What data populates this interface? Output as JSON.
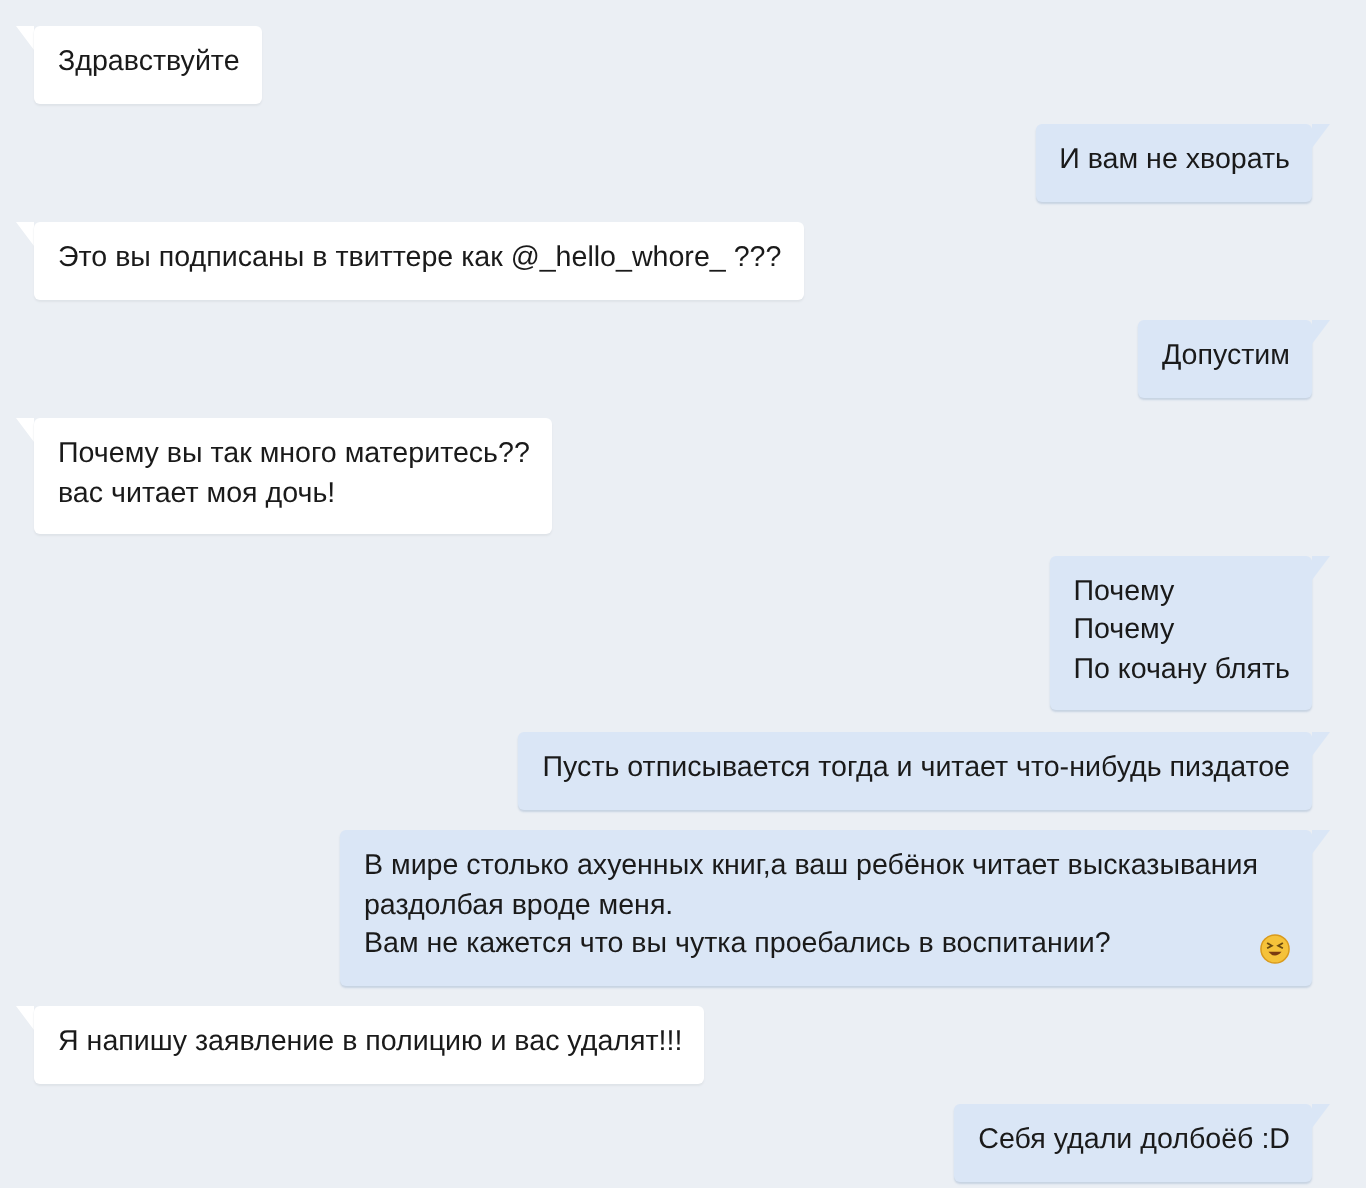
{
  "messages": [
    {
      "kind": "incoming",
      "lines": [
        "Здравствуйте"
      ]
    },
    {
      "kind": "outgoing",
      "lines": [
        "И вам не хворать"
      ]
    },
    {
      "kind": "incoming",
      "lines": [
        "Это вы подписаны в твиттере как @_hello_whore_ ???"
      ]
    },
    {
      "kind": "outgoing",
      "lines": [
        "Допустим"
      ]
    },
    {
      "kind": "incoming",
      "lines": [
        "Почему вы так много материтесь??",
        "вас читает моя дочь!"
      ]
    },
    {
      "kind": "outgoing",
      "lines": [
        "Почему",
        "Почему",
        "По кочану блять"
      ]
    },
    {
      "kind": "outgoing",
      "lines": [
        "Пусть отписывается тогда и читает что-нибудь пиздатое"
      ]
    },
    {
      "kind": "outgoing",
      "lines": [
        "В мире столько ахуенных книг,а ваш ребёнок читает высказывания",
        "раздолбая вроде меня.",
        "Вам не кажется что вы чутка проебались в воспитании?"
      ],
      "emoji": true
    },
    {
      "kind": "incoming",
      "lines": [
        "Я напишу заявление в полицию и вас удалят!!!"
      ]
    },
    {
      "kind": "outgoing",
      "lines": [
        "Себя удали долбоёб :D"
      ]
    }
  ]
}
